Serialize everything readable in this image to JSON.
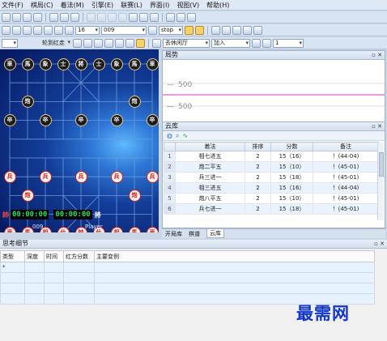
{
  "menu": [
    "文件(F)",
    "棋局(C)",
    "着法(M)",
    "引擎(E)",
    "联赛(L)",
    "界面(I)",
    "视图(V)",
    "帮助(H)"
  ],
  "toolbar2": {
    "combo1": "16",
    "combo2": "009",
    "combo3": "stop"
  },
  "toolbar3": {
    "mode": "轮到红走",
    "room": "去休闲厅",
    "action": "加入",
    "num": "1"
  },
  "trend": {
    "title": "局势",
    "tick_top": "500",
    "tick_bottom": "500"
  },
  "cloud": {
    "title": "云库",
    "headers": [
      "着法",
      "排序",
      "分数",
      "备注"
    ],
    "rows": [
      {
        "n": "1",
        "move": "相七进五",
        "rank": "2",
        "score": "15（16）",
        "note": "！(44-04)"
      },
      {
        "n": "2",
        "move": "炮二平五",
        "rank": "2",
        "score": "15（10）",
        "note": "！(45-01)"
      },
      {
        "n": "3",
        "move": "兵三进一",
        "rank": "2",
        "score": "15（18）",
        "note": "！(45-01)"
      },
      {
        "n": "4",
        "move": "相三进五",
        "rank": "2",
        "score": "15（16）",
        "note": "！(44-04)"
      },
      {
        "n": "5",
        "move": "炮八平五",
        "rank": "2",
        "score": "15（10）",
        "note": "！(45-01)"
      },
      {
        "n": "6",
        "move": "兵七进一",
        "rank": "2",
        "score": "15（18）",
        "note": "！(45-01)"
      }
    ]
  },
  "tabs": [
    "开局库",
    "棋谱",
    "云库"
  ],
  "board": {
    "pieces": [
      {
        "t": "車",
        "c": "b",
        "col": 0,
        "row": 0
      },
      {
        "t": "馬",
        "c": "b",
        "col": 1,
        "row": 0
      },
      {
        "t": "象",
        "c": "b",
        "col": 2,
        "row": 0
      },
      {
        "t": "士",
        "c": "b",
        "col": 3,
        "row": 0
      },
      {
        "t": "將",
        "c": "b",
        "col": 4,
        "row": 0
      },
      {
        "t": "士",
        "c": "b",
        "col": 5,
        "row": 0
      },
      {
        "t": "象",
        "c": "b",
        "col": 6,
        "row": 0
      },
      {
        "t": "馬",
        "c": "b",
        "col": 7,
        "row": 0
      },
      {
        "t": "車",
        "c": "b",
        "col": 8,
        "row": 0
      },
      {
        "t": "炮",
        "c": "b",
        "col": 1,
        "row": 2
      },
      {
        "t": "炮",
        "c": "b",
        "col": 7,
        "row": 2
      },
      {
        "t": "卒",
        "c": "b",
        "col": 0,
        "row": 3
      },
      {
        "t": "卒",
        "c": "b",
        "col": 2,
        "row": 3
      },
      {
        "t": "卒",
        "c": "b",
        "col": 4,
        "row": 3
      },
      {
        "t": "卒",
        "c": "b",
        "col": 6,
        "row": 3
      },
      {
        "t": "卒",
        "c": "b",
        "col": 8,
        "row": 3
      },
      {
        "t": "兵",
        "c": "r",
        "col": 0,
        "row": 6
      },
      {
        "t": "兵",
        "c": "r",
        "col": 2,
        "row": 6
      },
      {
        "t": "兵",
        "c": "r",
        "col": 4,
        "row": 6
      },
      {
        "t": "兵",
        "c": "r",
        "col": 6,
        "row": 6
      },
      {
        "t": "兵",
        "c": "r",
        "col": 8,
        "row": 6
      },
      {
        "t": "炮",
        "c": "r",
        "col": 1,
        "row": 7
      },
      {
        "t": "炮",
        "c": "r",
        "col": 7,
        "row": 7
      },
      {
        "t": "車",
        "c": "r",
        "col": 0,
        "row": 9
      },
      {
        "t": "馬",
        "c": "r",
        "col": 1,
        "row": 9
      },
      {
        "t": "相",
        "c": "r",
        "col": 2,
        "row": 9
      },
      {
        "t": "仕",
        "c": "r",
        "col": 3,
        "row": 9
      },
      {
        "t": "帥",
        "c": "r",
        "col": 4,
        "row": 9
      },
      {
        "t": "仕",
        "c": "r",
        "col": 5,
        "row": 9
      },
      {
        "t": "相",
        "c": "r",
        "col": 6,
        "row": 9
      },
      {
        "t": "馬",
        "c": "r",
        "col": 7,
        "row": 9
      },
      {
        "t": "車",
        "c": "r",
        "col": 8,
        "row": 9
      }
    ],
    "red_label": "帥",
    "black_label": "將",
    "red_clock": "00:00:00",
    "black_clock": "00:00:00",
    "red_player": "009",
    "black_player": "Player"
  },
  "think": {
    "title": "思考细节",
    "headers": [
      "类型",
      "深度",
      "时间",
      "红方分数",
      "主要变例"
    ],
    "row_marker": "*"
  },
  "watermark": "最需网",
  "colors": {
    "accent": "#f2b24a",
    "trend_line": "#e35fd1",
    "clock": "#25e05a"
  }
}
